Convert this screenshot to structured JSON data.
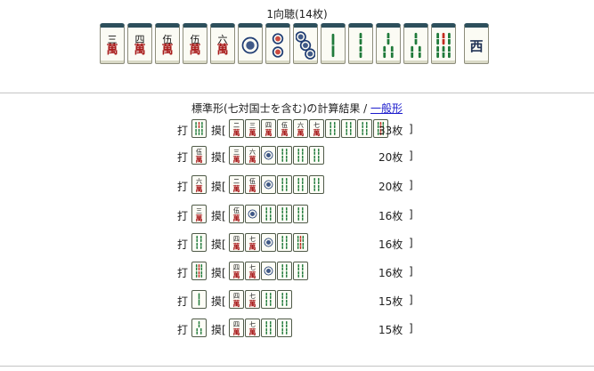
{
  "hand": {
    "title": "1向聴(14枚)",
    "tiles": [
      {
        "suit": "man",
        "num": 3,
        "top": "三",
        "bot": "萬"
      },
      {
        "suit": "man",
        "num": 4,
        "top": "四",
        "bot": "萬"
      },
      {
        "suit": "man",
        "num": 5,
        "top": "伍",
        "bot": "萬"
      },
      {
        "suit": "man",
        "num": 5,
        "top": "伍",
        "bot": "萬"
      },
      {
        "suit": "man",
        "num": 6,
        "top": "六",
        "bot": "萬"
      },
      {
        "suit": "pin",
        "num": 1
      },
      {
        "suit": "pin",
        "num": 2
      },
      {
        "suit": "pin",
        "num": 3
      },
      {
        "suit": "sou",
        "num": 1
      },
      {
        "suit": "sou",
        "num": 2
      },
      {
        "suit": "sou",
        "num": 3
      },
      {
        "suit": "sou",
        "num": 3
      },
      {
        "suit": "sou",
        "num": 7
      },
      {
        "suit": "honor",
        "label": "西"
      }
    ]
  },
  "results": {
    "heading_prefix": "標準形(七対国士を含む)の計算結果 / ",
    "link_label": "一般形",
    "discard_label": "打",
    "draw_label": "摸[",
    "close_label": "]",
    "rows": [
      {
        "discard": {
          "suit": "sou",
          "num": 7
        },
        "draws": [
          {
            "suit": "man",
            "num": 2
          },
          {
            "suit": "man",
            "num": 3
          },
          {
            "suit": "man",
            "num": 4
          },
          {
            "suit": "man",
            "num": 5
          },
          {
            "suit": "man",
            "num": 6
          },
          {
            "suit": "man",
            "num": 7
          },
          {
            "suit": "sou",
            "num": 4
          },
          {
            "suit": "sou",
            "num": 4
          },
          {
            "suit": "sou",
            "num": 4
          },
          {
            "suit": "sou",
            "num": 5
          }
        ],
        "count": "33枚"
      },
      {
        "discard": {
          "suit": "man",
          "num": 5
        },
        "draws": [
          {
            "suit": "man",
            "num": 3
          },
          {
            "suit": "man",
            "num": 6
          },
          {
            "suit": "pin",
            "num": 1
          },
          {
            "suit": "sou",
            "num": 4
          },
          {
            "suit": "sou",
            "num": 4
          },
          {
            "suit": "sou",
            "num": 4
          }
        ],
        "count": "20枚"
      },
      {
        "discard": {
          "suit": "man",
          "num": 6
        },
        "draws": [
          {
            "suit": "man",
            "num": 2
          },
          {
            "suit": "man",
            "num": 5
          },
          {
            "suit": "pin",
            "num": 1
          },
          {
            "suit": "sou",
            "num": 4
          },
          {
            "suit": "sou",
            "num": 4
          },
          {
            "suit": "sou",
            "num": 4
          }
        ],
        "count": "20枚"
      },
      {
        "discard": {
          "suit": "man",
          "num": 3
        },
        "draws": [
          {
            "suit": "man",
            "num": 5
          },
          {
            "suit": "pin",
            "num": 1
          },
          {
            "suit": "sou",
            "num": 4
          },
          {
            "suit": "sou",
            "num": 4
          },
          {
            "suit": "sou",
            "num": 4
          }
        ],
        "count": "16枚"
      },
      {
        "discard": {
          "suit": "sou",
          "num": 4
        },
        "draws": [
          {
            "suit": "man",
            "num": 4
          },
          {
            "suit": "man",
            "num": 7
          },
          {
            "suit": "pin",
            "num": 1
          },
          {
            "suit": "sou",
            "num": 4
          },
          {
            "suit": "sou",
            "num": 5
          }
        ],
        "count": "16枚"
      },
      {
        "discard": {
          "suit": "sou",
          "num": 5
        },
        "draws": [
          {
            "suit": "man",
            "num": 4
          },
          {
            "suit": "man",
            "num": 7
          },
          {
            "suit": "pin",
            "num": 1
          },
          {
            "suit": "sou",
            "num": 4
          },
          {
            "suit": "sou",
            "num": 4
          }
        ],
        "count": "16枚"
      },
      {
        "discard": {
          "suit": "sou",
          "num": 1
        },
        "draws": [
          {
            "suit": "man",
            "num": 4
          },
          {
            "suit": "man",
            "num": 7
          },
          {
            "suit": "sou",
            "num": 4
          },
          {
            "suit": "sou",
            "num": 4
          }
        ],
        "count": "15枚"
      },
      {
        "discard": {
          "suit": "sou",
          "num": 3
        },
        "draws": [
          {
            "suit": "man",
            "num": 4
          },
          {
            "suit": "man",
            "num": 7
          },
          {
            "suit": "sou",
            "num": 4
          },
          {
            "suit": "sou",
            "num": 4
          }
        ],
        "count": "15枚"
      }
    ]
  },
  "colors": {
    "pin_blue": "#1f3c73",
    "pin_red": "#c22a1e",
    "sou_green": "#1f7a3a",
    "sou_red": "#c22a1e",
    "man_red": "#a81b1b",
    "tile_back": "#2d4f5c",
    "link": "#1a1acc"
  }
}
